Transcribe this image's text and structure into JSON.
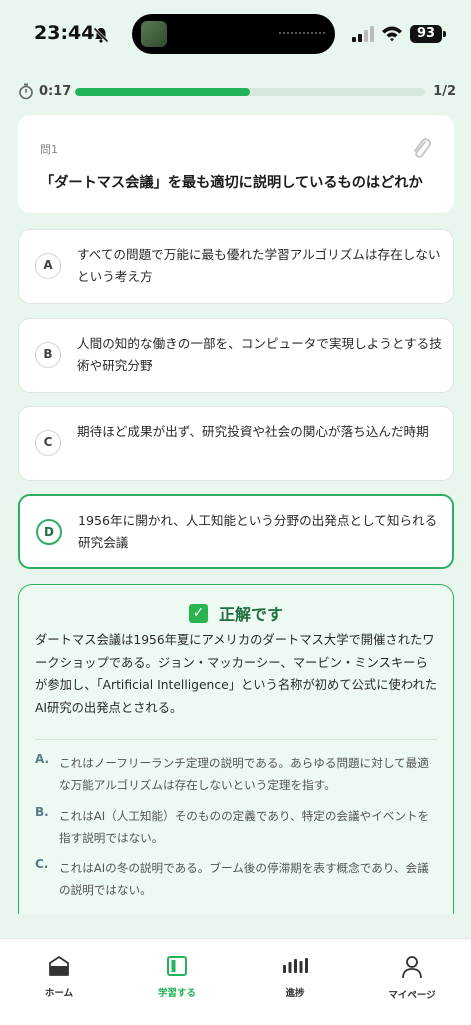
{
  "status_bar": {
    "time": "23:44",
    "battery": "93"
  },
  "quiz": {
    "timer": "0:17",
    "progress_fraction": 0.5,
    "count": "1/2"
  },
  "question": {
    "label": "問1",
    "text": "「ダートマス会議」を最も適切に説明しているものはどれか"
  },
  "options": [
    {
      "letter": "A",
      "text": "すべての問題で万能に最も優れた学習アルゴリズムは存在しないという考え方"
    },
    {
      "letter": "B",
      "text": "人間の知的な働きの一部を、コンピュータで実現しようとする技術や研究分野"
    },
    {
      "letter": "C",
      "text": "期待ほど成果が出ず、研究投資や社会の関心が落ち込んだ時期"
    },
    {
      "letter": "D",
      "text": "1956年に開かれ、人工知能という分野の出発点として知られる研究会議"
    }
  ],
  "explanation": {
    "result": "正解です",
    "body": "ダートマス会議は1956年夏にアメリカのダートマス大学で開催されたワークショップである。ジョン・マッカーシー、マービン・ミンスキーらが参加し、「Artificial Intelligence」という名称が初めて公式に使われたAI研究の出発点とされる。",
    "alternatives": [
      {
        "letter": "A.",
        "text": "これはノーフリーランチ定理の説明である。あらゆる問題に対して最適な万能アルゴリズムは存在しないという定理を指す。"
      },
      {
        "letter": "B.",
        "text": "これはAI（人工知能）そのものの定義であり、特定の会議やイベントを指す説明ではない。"
      },
      {
        "letter": "C.",
        "text": "これはAIの冬の説明である。ブーム後の停滞期を表す概念であり、会議の説明ではない。"
      }
    ]
  },
  "tabs": [
    {
      "label": "ホーム",
      "icon": "home-icon"
    },
    {
      "label": "学習する",
      "icon": "book-icon"
    },
    {
      "label": "進捗",
      "icon": "chart-icon"
    },
    {
      "label": "マイページ",
      "icon": "person-icon"
    }
  ],
  "colors": {
    "accent": "#22b45a",
    "correct_border": "#2fae63",
    "background": "#e8f6ee"
  }
}
